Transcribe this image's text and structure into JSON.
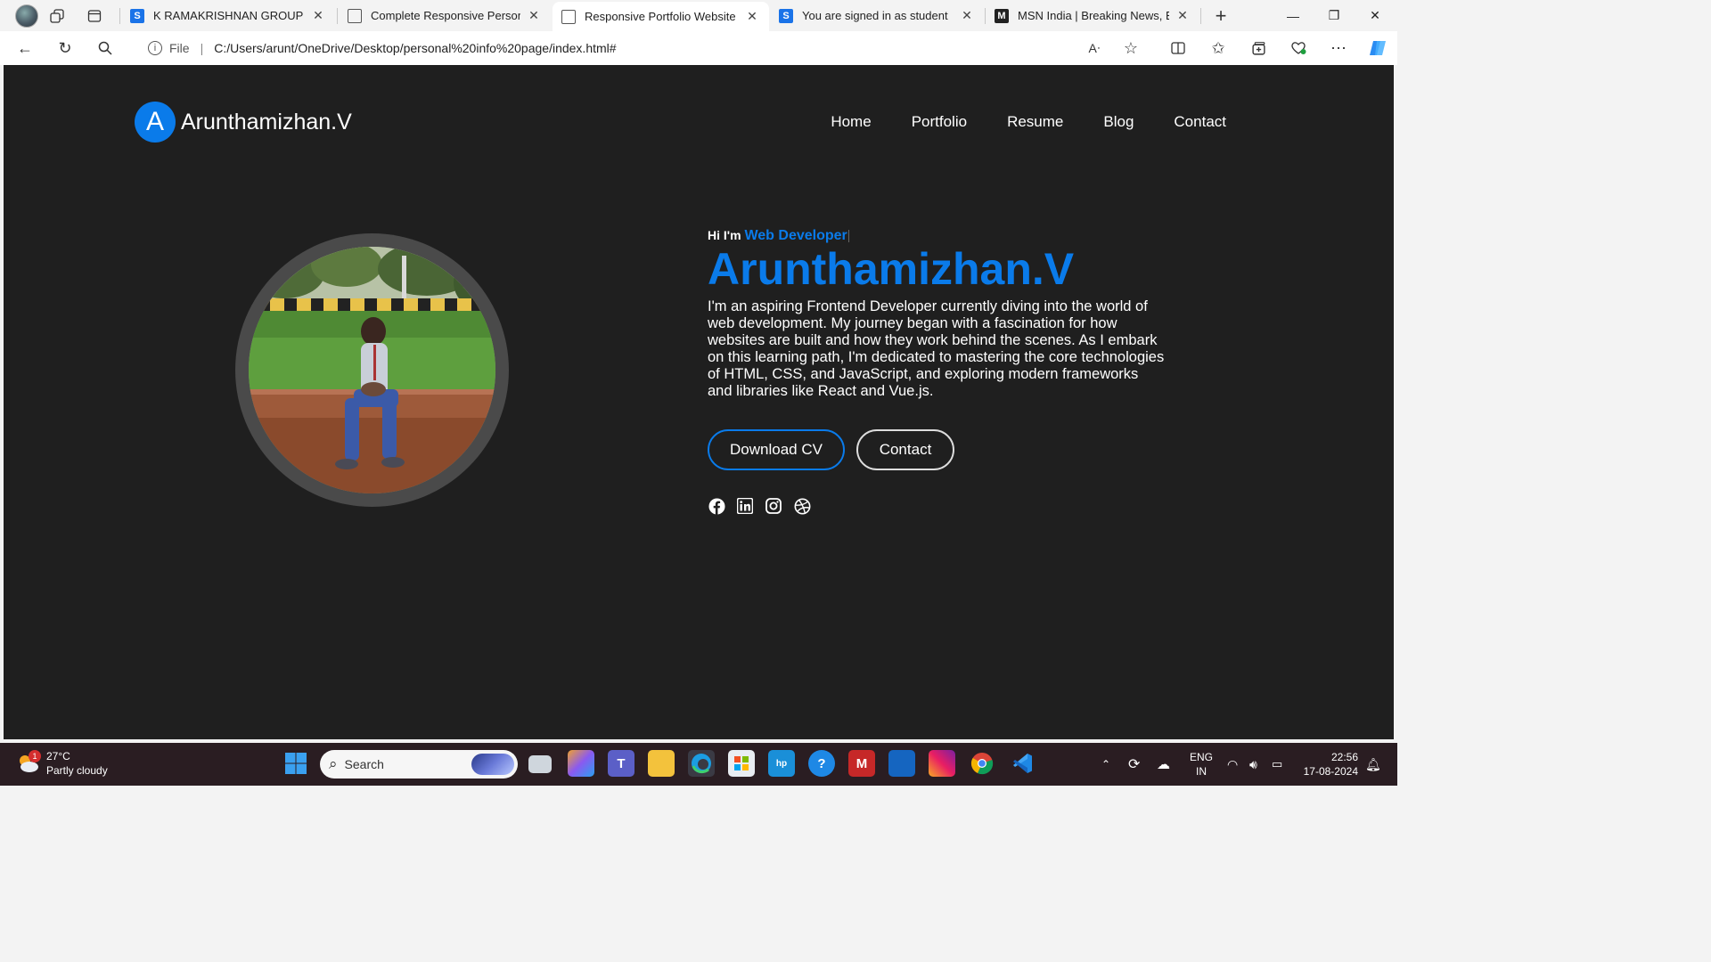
{
  "browser": {
    "tabs": [
      {
        "title": "K RAMAKRISHNAN GROUP OF INSTITUTIONS",
        "icon": "s-logo-icon",
        "active": false
      },
      {
        "title": "Complete Responsive Personal Portfolio",
        "icon": "document-icon",
        "active": false
      },
      {
        "title": "Responsive Portfolio Website Design",
        "icon": "document-icon",
        "active": true
      },
      {
        "title": "You are signed in as student",
        "icon": "s-logo-icon",
        "active": false
      },
      {
        "title": "MSN India | Breaking News, Entertainment",
        "icon": "msn-icon",
        "active": false
      }
    ],
    "new_tab_symbol": "+",
    "url_scheme_label": "File",
    "url": "C:/Users/arunt/OneDrive/Desktop/personal%20info%20page/index.html#"
  },
  "site": {
    "logo_letter": "A",
    "brand_name": "Arunthamizhan.V",
    "nav": [
      "Home",
      "Portfolio",
      "Resume",
      "Blog",
      "Contact"
    ],
    "greeting": "Hi I'm",
    "role": "Web Developer",
    "name": "Arunthamizhan.V",
    "description": "I'm an aspiring Frontend Developer currently diving into the world of web development. My journey began with a fascination for how websites are built and how they work behind the scenes. As I embark on this learning path, I'm dedicated to mastering the core technologies of HTML, CSS, and JavaScript, and exploring modern frameworks and libraries like React and Vue.js.",
    "buttons": {
      "download_cv": "Download CV",
      "contact": "Contact"
    },
    "socials": [
      "facebook-icon",
      "linkedin-icon",
      "instagram-icon",
      "dribbble-icon"
    ],
    "colors": {
      "accent": "#0a7bea",
      "background": "#1f1f1f",
      "ring": "#4a4a4a"
    }
  },
  "taskbar": {
    "weather_temp": "27°C",
    "weather_desc": "Partly cloudy",
    "weather_badge": "1",
    "search_placeholder": "Search",
    "lang_line1": "ENG",
    "lang_line2": "IN",
    "time": "22:56",
    "date": "17-08-2024"
  }
}
